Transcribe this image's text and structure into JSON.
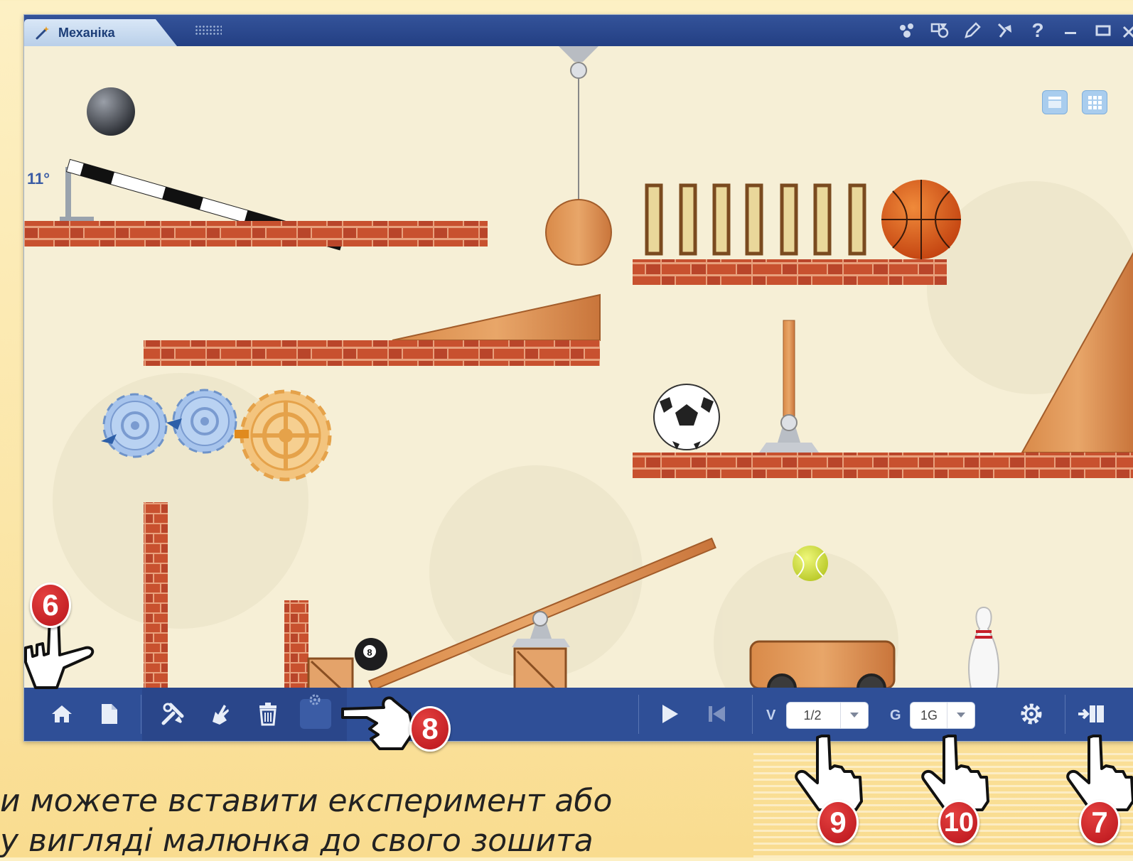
{
  "window": {
    "tab_label": "Механіка",
    "tab_icon": "wand-icon",
    "title_icons": [
      "molecule-icon",
      "tools-icon",
      "pencil-icon",
      "pin-icon",
      "help-icon",
      "minimize-icon",
      "maximize-icon",
      "close-icon"
    ]
  },
  "scene": {
    "angle_label": "11°",
    "eight_ball_label": "8"
  },
  "toolbar": {
    "velocity_label": "V",
    "velocity_value": "1/2",
    "gravity_label": "G",
    "gravity_value": "1G"
  },
  "callouts": [
    "6",
    "8",
    "9",
    "10",
    "7"
  ],
  "caption": {
    "line1": "и можете вставити експеримент або",
    "line2": "у вигляді малюнка до свого зошита"
  },
  "colors": {
    "toolbar_bg": "#2f4f97",
    "titlebar_bg": "#233f83",
    "canvas_bg": "#f6efd6",
    "brick": "#c8512f",
    "badge": "#c81d22"
  }
}
